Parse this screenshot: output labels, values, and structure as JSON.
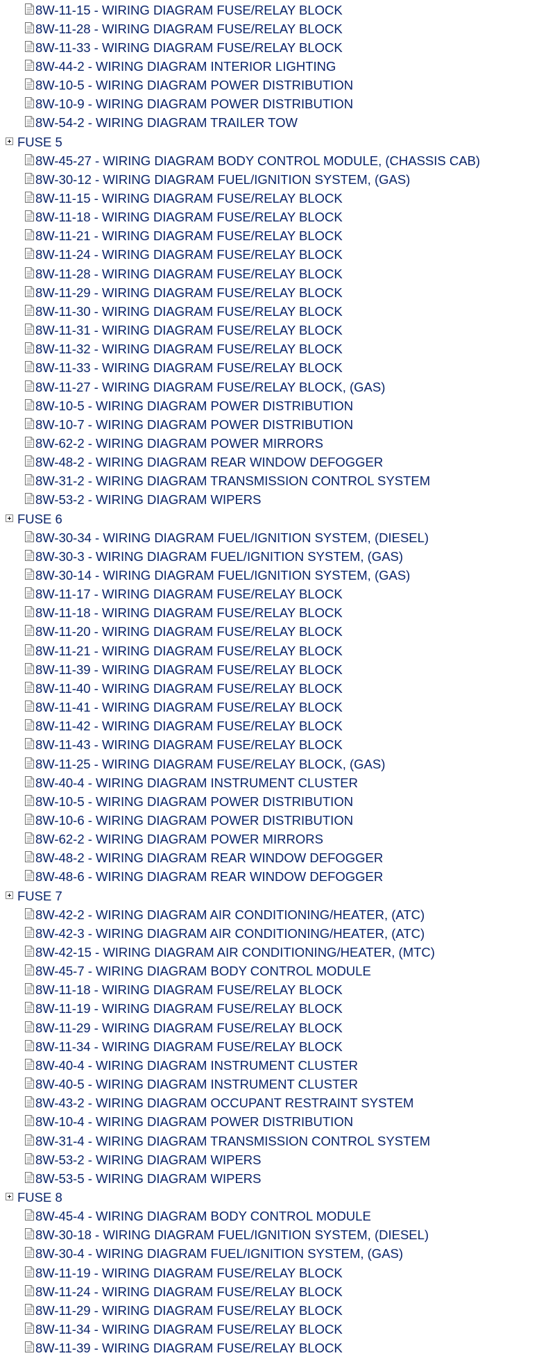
{
  "tree": [
    {
      "type": "leaf",
      "text": "8W-11-15 - WIRING DIAGRAM FUSE/RELAY BLOCK"
    },
    {
      "type": "leaf",
      "text": "8W-11-28 - WIRING DIAGRAM FUSE/RELAY BLOCK"
    },
    {
      "type": "leaf",
      "text": "8W-11-33 - WIRING DIAGRAM FUSE/RELAY BLOCK"
    },
    {
      "type": "leaf",
      "text": "8W-44-2 - WIRING DIAGRAM INTERIOR LIGHTING"
    },
    {
      "type": "leaf",
      "text": "8W-10-5 - WIRING DIAGRAM POWER DISTRIBUTION"
    },
    {
      "type": "leaf",
      "text": "8W-10-9 - WIRING DIAGRAM POWER DISTRIBUTION"
    },
    {
      "type": "leaf",
      "text": "8W-54-2 - WIRING DIAGRAM TRAILER TOW"
    },
    {
      "type": "group",
      "text": "FUSE 5"
    },
    {
      "type": "leaf",
      "text": "8W-45-27 - WIRING DIAGRAM BODY CONTROL MODULE, (CHASSIS CAB)"
    },
    {
      "type": "leaf",
      "text": "8W-30-12 - WIRING DIAGRAM FUEL/IGNITION SYSTEM, (GAS)"
    },
    {
      "type": "leaf",
      "text": "8W-11-15 - WIRING DIAGRAM FUSE/RELAY BLOCK"
    },
    {
      "type": "leaf",
      "text": "8W-11-18 - WIRING DIAGRAM FUSE/RELAY BLOCK"
    },
    {
      "type": "leaf",
      "text": "8W-11-21 - WIRING DIAGRAM FUSE/RELAY BLOCK"
    },
    {
      "type": "leaf",
      "text": "8W-11-24 - WIRING DIAGRAM FUSE/RELAY BLOCK"
    },
    {
      "type": "leaf",
      "text": "8W-11-28 - WIRING DIAGRAM FUSE/RELAY BLOCK"
    },
    {
      "type": "leaf",
      "text": "8W-11-29 - WIRING DIAGRAM FUSE/RELAY BLOCK"
    },
    {
      "type": "leaf",
      "text": "8W-11-30 - WIRING DIAGRAM FUSE/RELAY BLOCK"
    },
    {
      "type": "leaf",
      "text": "8W-11-31 - WIRING DIAGRAM FUSE/RELAY BLOCK"
    },
    {
      "type": "leaf",
      "text": "8W-11-32 - WIRING DIAGRAM FUSE/RELAY BLOCK"
    },
    {
      "type": "leaf",
      "text": "8W-11-33 - WIRING DIAGRAM FUSE/RELAY BLOCK"
    },
    {
      "type": "leaf",
      "text": "8W-11-27 - WIRING DIAGRAM FUSE/RELAY BLOCK, (GAS)"
    },
    {
      "type": "leaf",
      "text": "8W-10-5 - WIRING DIAGRAM POWER DISTRIBUTION"
    },
    {
      "type": "leaf",
      "text": "8W-10-7 - WIRING DIAGRAM POWER DISTRIBUTION"
    },
    {
      "type": "leaf",
      "text": "8W-62-2 - WIRING DIAGRAM POWER MIRRORS"
    },
    {
      "type": "leaf",
      "text": "8W-48-2 - WIRING DIAGRAM REAR WINDOW DEFOGGER"
    },
    {
      "type": "leaf",
      "text": "8W-31-2 - WIRING DIAGRAM TRANSMISSION CONTROL SYSTEM"
    },
    {
      "type": "leaf",
      "text": "8W-53-2 - WIRING DIAGRAM WIPERS"
    },
    {
      "type": "group",
      "text": "FUSE 6"
    },
    {
      "type": "leaf",
      "text": "8W-30-34 - WIRING DIAGRAM FUEL/IGNITION SYSTEM, (DIESEL)"
    },
    {
      "type": "leaf",
      "text": "8W-30-3 - WIRING DIAGRAM FUEL/IGNITION SYSTEM, (GAS)"
    },
    {
      "type": "leaf",
      "text": "8W-30-14 - WIRING DIAGRAM FUEL/IGNITION SYSTEM, (GAS)"
    },
    {
      "type": "leaf",
      "text": "8W-11-17 - WIRING DIAGRAM FUSE/RELAY BLOCK"
    },
    {
      "type": "leaf",
      "text": "8W-11-18 - WIRING DIAGRAM FUSE/RELAY BLOCK"
    },
    {
      "type": "leaf",
      "text": "8W-11-20 - WIRING DIAGRAM FUSE/RELAY BLOCK"
    },
    {
      "type": "leaf",
      "text": "8W-11-21 - WIRING DIAGRAM FUSE/RELAY BLOCK"
    },
    {
      "type": "leaf",
      "text": "8W-11-39 - WIRING DIAGRAM FUSE/RELAY BLOCK"
    },
    {
      "type": "leaf",
      "text": "8W-11-40 - WIRING DIAGRAM FUSE/RELAY BLOCK"
    },
    {
      "type": "leaf",
      "text": "8W-11-41 - WIRING DIAGRAM FUSE/RELAY BLOCK"
    },
    {
      "type": "leaf",
      "text": "8W-11-42 - WIRING DIAGRAM FUSE/RELAY BLOCK"
    },
    {
      "type": "leaf",
      "text": "8W-11-43 - WIRING DIAGRAM FUSE/RELAY BLOCK"
    },
    {
      "type": "leaf",
      "text": "8W-11-25 - WIRING DIAGRAM FUSE/RELAY BLOCK, (GAS)"
    },
    {
      "type": "leaf",
      "text": "8W-40-4 - WIRING DIAGRAM INSTRUMENT CLUSTER"
    },
    {
      "type": "leaf",
      "text": "8W-10-5 - WIRING DIAGRAM POWER DISTRIBUTION"
    },
    {
      "type": "leaf",
      "text": "8W-10-6 - WIRING DIAGRAM POWER DISTRIBUTION"
    },
    {
      "type": "leaf",
      "text": "8W-62-2 - WIRING DIAGRAM POWER MIRRORS"
    },
    {
      "type": "leaf",
      "text": "8W-48-2 - WIRING DIAGRAM REAR WINDOW DEFOGGER"
    },
    {
      "type": "leaf",
      "text": "8W-48-6 - WIRING DIAGRAM REAR WINDOW DEFOGGER"
    },
    {
      "type": "group",
      "text": "FUSE 7"
    },
    {
      "type": "leaf",
      "text": "8W-42-2 - WIRING DIAGRAM AIR CONDITIONING/HEATER, (ATC)"
    },
    {
      "type": "leaf",
      "text": "8W-42-3 - WIRING DIAGRAM AIR CONDITIONING/HEATER, (ATC)"
    },
    {
      "type": "leaf",
      "text": "8W-42-15 - WIRING DIAGRAM AIR CONDITIONING/HEATER, (MTC)"
    },
    {
      "type": "leaf",
      "text": "8W-45-7 - WIRING DIAGRAM BODY CONTROL MODULE"
    },
    {
      "type": "leaf",
      "text": "8W-11-18 - WIRING DIAGRAM FUSE/RELAY BLOCK"
    },
    {
      "type": "leaf",
      "text": "8W-11-19 - WIRING DIAGRAM FUSE/RELAY BLOCK"
    },
    {
      "type": "leaf",
      "text": "8W-11-29 - WIRING DIAGRAM FUSE/RELAY BLOCK"
    },
    {
      "type": "leaf",
      "text": "8W-11-34 - WIRING DIAGRAM FUSE/RELAY BLOCK"
    },
    {
      "type": "leaf",
      "text": "8W-40-4 - WIRING DIAGRAM INSTRUMENT CLUSTER"
    },
    {
      "type": "leaf",
      "text": "8W-40-5 - WIRING DIAGRAM INSTRUMENT CLUSTER"
    },
    {
      "type": "leaf",
      "text": "8W-43-2 - WIRING DIAGRAM OCCUPANT RESTRAINT SYSTEM"
    },
    {
      "type": "leaf",
      "text": "8W-10-4 - WIRING DIAGRAM POWER DISTRIBUTION"
    },
    {
      "type": "leaf",
      "text": "8W-31-4 - WIRING DIAGRAM TRANSMISSION CONTROL SYSTEM"
    },
    {
      "type": "leaf",
      "text": "8W-53-2 - WIRING DIAGRAM WIPERS"
    },
    {
      "type": "leaf",
      "text": "8W-53-5 - WIRING DIAGRAM WIPERS"
    },
    {
      "type": "group",
      "text": "FUSE 8"
    },
    {
      "type": "leaf",
      "text": "8W-45-4 - WIRING DIAGRAM BODY CONTROL MODULE"
    },
    {
      "type": "leaf",
      "text": "8W-30-18 - WIRING DIAGRAM FUEL/IGNITION SYSTEM, (DIESEL)"
    },
    {
      "type": "leaf",
      "text": "8W-30-4 - WIRING DIAGRAM FUEL/IGNITION SYSTEM, (GAS)"
    },
    {
      "type": "leaf",
      "text": "8W-11-19 - WIRING DIAGRAM FUSE/RELAY BLOCK"
    },
    {
      "type": "leaf",
      "text": "8W-11-24 - WIRING DIAGRAM FUSE/RELAY BLOCK"
    },
    {
      "type": "leaf",
      "text": "8W-11-29 - WIRING DIAGRAM FUSE/RELAY BLOCK"
    },
    {
      "type": "leaf",
      "text": "8W-11-34 - WIRING DIAGRAM FUSE/RELAY BLOCK"
    },
    {
      "type": "leaf",
      "text": "8W-11-39 - WIRING DIAGRAM FUSE/RELAY BLOCK"
    }
  ]
}
